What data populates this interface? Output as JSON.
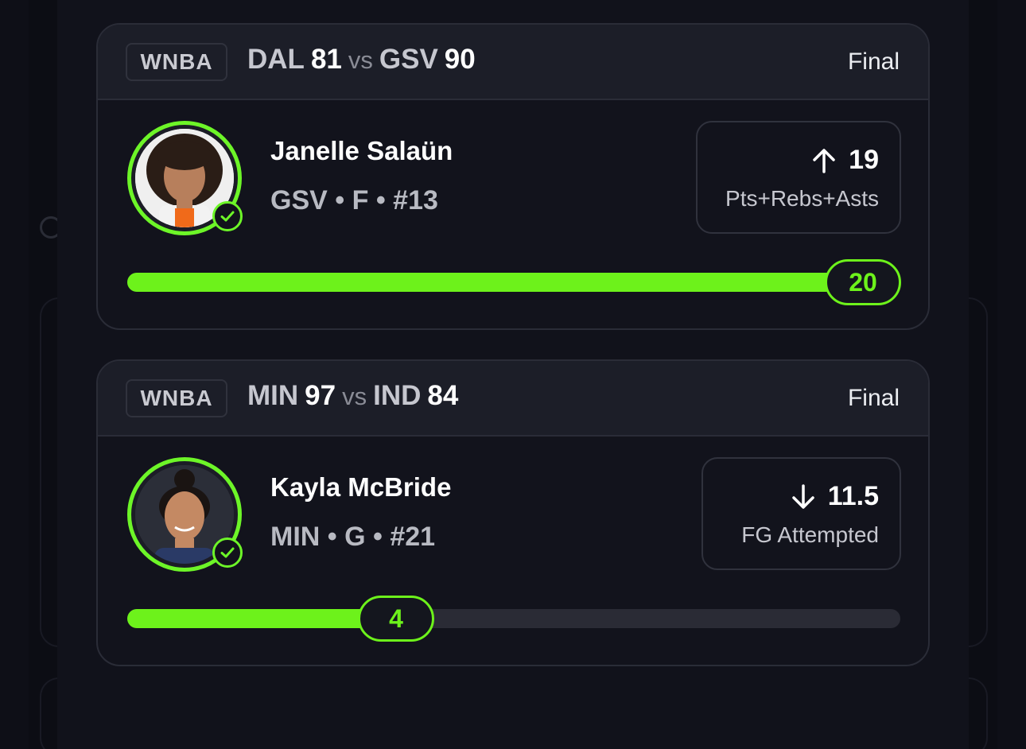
{
  "colors": {
    "accent": "#6df21b",
    "background": "#11121b",
    "card_header": "#1c1e28"
  },
  "cards": [
    {
      "league": "WNBA",
      "team1": "DAL",
      "score1": "81",
      "vs": "vs",
      "team2": "GSV",
      "score2": "90",
      "status": "Final",
      "player": {
        "name": "Janelle Salaün",
        "team": "GSV",
        "position": "F",
        "number": "#13",
        "meta": "GSV • F • #13"
      },
      "pick": {
        "direction": "up",
        "line": "19",
        "stat": "Pts+Rebs+Asts"
      },
      "progress": {
        "value": "20",
        "fraction": 1.0
      }
    },
    {
      "league": "WNBA",
      "team1": "MIN",
      "score1": "97",
      "vs": "vs",
      "team2": "IND",
      "score2": "84",
      "status": "Final",
      "player": {
        "name": "Kayla McBride",
        "team": "MIN",
        "position": "G",
        "number": "#21",
        "meta": "MIN • G • #21"
      },
      "pick": {
        "direction": "down",
        "line": "11.5",
        "stat": "FG Attempted"
      },
      "progress": {
        "value": "4",
        "fraction": 0.35
      }
    }
  ],
  "icons": {
    "up": "arrow-up-icon",
    "down": "arrow-down-icon",
    "check": "check-circle-icon"
  }
}
